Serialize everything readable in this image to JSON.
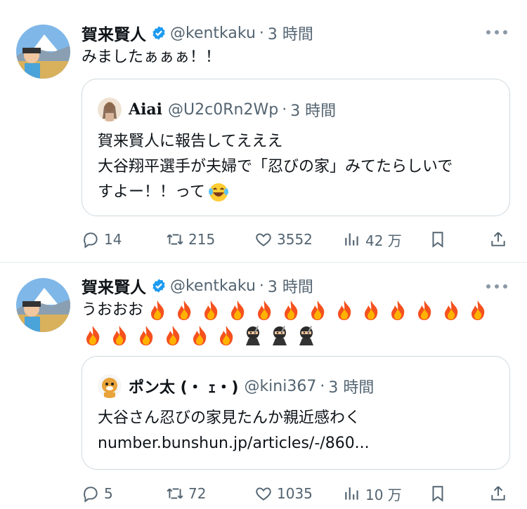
{
  "tweets": [
    {
      "author": "賀来賢人",
      "handle": "@kentkaku",
      "dot": "·",
      "time": "3 時間",
      "text_lines": [
        "みましたぁぁぁ！！"
      ],
      "quote": {
        "author": "Aiai",
        "handle": "@U2c0Rn2Wp",
        "dot": "·",
        "time": "3 時間",
        "lines": [
          "賀来賢人に報告してえええ",
          "大谷翔平選手が夫婦で「忍びの家」みてたらしいで",
          "すよー！！って"
        ]
      },
      "stats": {
        "replies": "14",
        "retweets": "215",
        "likes": "3552",
        "views": "42 万"
      }
    },
    {
      "author": "賀来賢人",
      "handle": "@kentkaku",
      "dot": "·",
      "time": "3 時間",
      "text_lines": [
        "うおおお"
      ],
      "quote": {
        "author": "ポン太 (・ ｪ・)",
        "handle": "@kini367",
        "dot": "·",
        "time": "3 時間",
        "lines": [
          "大谷さん忍びの家見たんか親近感わく",
          "number.bunshun.jp/articles/-/860..."
        ]
      },
      "stats": {
        "replies": "5",
        "retweets": "72",
        "likes": "1035",
        "views": "10 万"
      }
    }
  ],
  "colors": {
    "verified": "#1d9bf0",
    "secondary_text": "#536471",
    "border": "#cfd9de",
    "fire": "#ff6a00"
  },
  "icons": [
    "verified-badge-icon",
    "more-icon",
    "reply-icon",
    "retweet-icon",
    "like-icon",
    "views-icon",
    "bookmark-icon",
    "share-icon",
    "fire-emoji",
    "ninja-emoji",
    "laughing-emoji"
  ]
}
